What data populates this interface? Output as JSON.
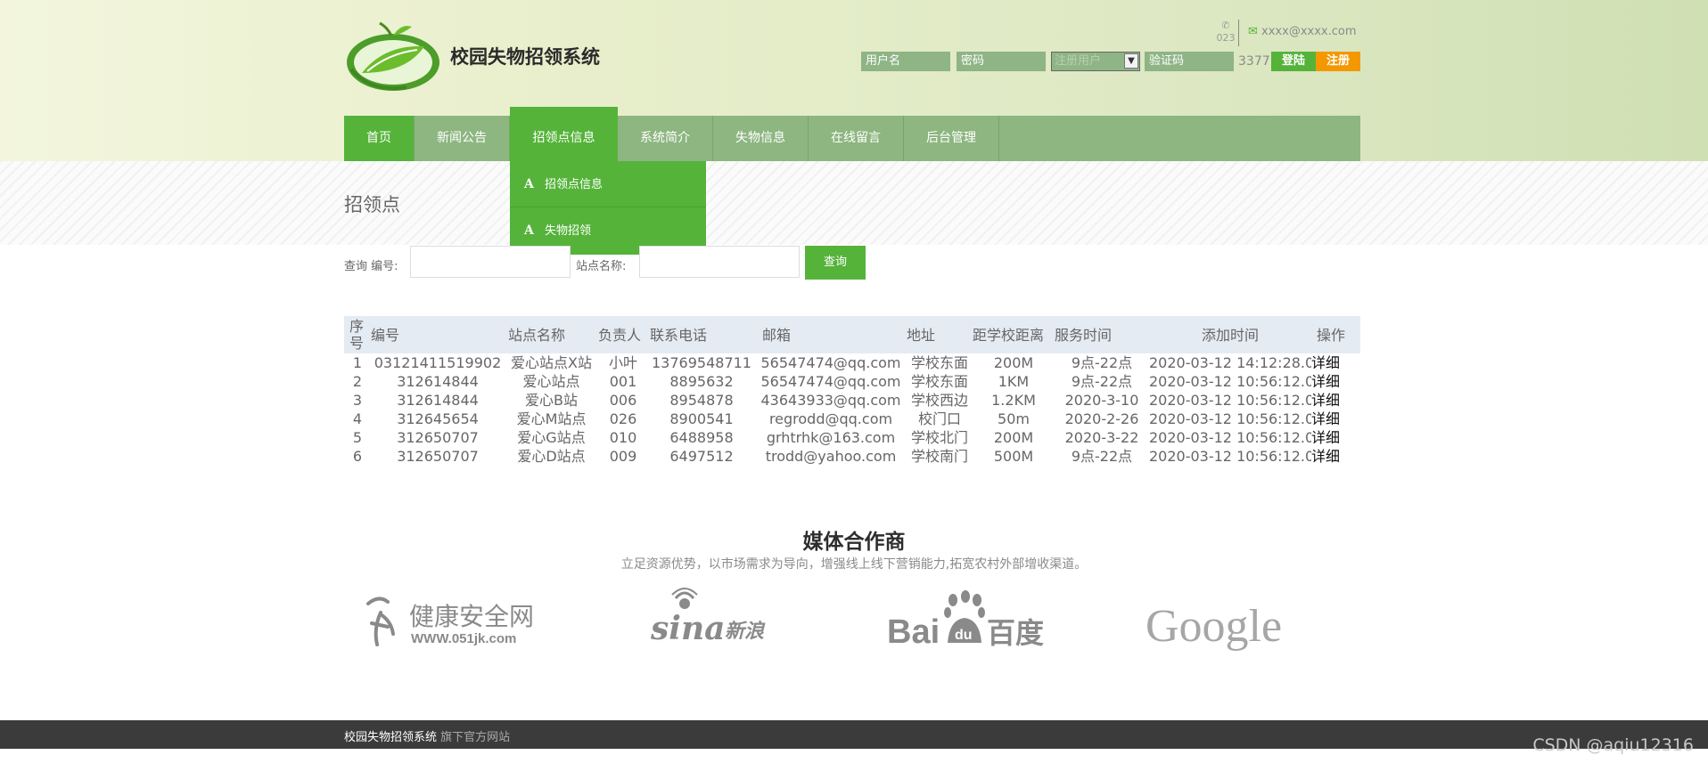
{
  "header": {
    "site_title": "校园失物招领系统",
    "phone_icon": "phone-icon",
    "phone_text": "023",
    "email_icon": "envelope-icon",
    "email": "xxxx@xxxx.com"
  },
  "login": {
    "username_placeholder": "用户名",
    "password_placeholder": "密码",
    "role_selected": "注册用户",
    "captcha_placeholder": "验证码",
    "captcha_code": "3377",
    "login_label": "登陆",
    "register_label": "注册"
  },
  "nav": {
    "items": [
      {
        "label": "首页"
      },
      {
        "label": "新闻公告"
      },
      {
        "label": "招领点信息"
      },
      {
        "label": "系统简介"
      },
      {
        "label": "失物信息"
      },
      {
        "label": "在线留言"
      },
      {
        "label": "后台管理"
      }
    ],
    "dropdown": [
      {
        "label": "招领点信息",
        "icon": "A"
      },
      {
        "label": "失物招领",
        "icon": "A"
      }
    ]
  },
  "page": {
    "section_title": "招领点",
    "search": {
      "label_prefix": "查询 编号:",
      "label_name": "站点名称:",
      "button": "查询"
    }
  },
  "table": {
    "headers": [
      "序号",
      "编号",
      "站点名称",
      "负责人",
      "联系电话",
      "邮箱",
      "地址",
      "距学校距离",
      "服务时间",
      "添加时间",
      "操作"
    ],
    "rows": [
      [
        "1",
        "03121411519902",
        "爱心站点X站",
        "小叶",
        "13769548711",
        "56547474@qq.com",
        "学校东面",
        "200M",
        "9点-22点",
        "2020-03-12 14:12:28.0",
        "详细"
      ],
      [
        "2",
        "312614844",
        "爱心站点",
        "001",
        "8895632",
        "56547474@qq.com",
        "学校东面",
        "1KM",
        "9点-22点",
        "2020-03-12 10:56:12.0",
        "详细"
      ],
      [
        "3",
        "312614844",
        "爱心B站",
        "006",
        "8954878",
        "43643933@qq.com",
        "学校西边",
        "1.2KM",
        "2020-3-10",
        "2020-03-12 10:56:12.0",
        "详细"
      ],
      [
        "4",
        "312645654",
        "爱心M站点",
        "026",
        "8900541",
        "regrodd@qq.com",
        "校门口",
        "50m",
        "2020-2-26",
        "2020-03-12 10:56:12.0",
        "详细"
      ],
      [
        "5",
        "312650707",
        "爱心G站点",
        "010",
        "6488958",
        "grhtrhk@163.com",
        "学校北门",
        "200M",
        "2020-3-22",
        "2020-03-12 10:56:12.0",
        "详细"
      ],
      [
        "6",
        "312650707",
        "爱心D站点",
        "009",
        "6497512",
        "trodd@yahoo.com",
        "学校南门",
        "500M",
        "9点-22点",
        "2020-03-12 10:56:12.0",
        "详细"
      ]
    ]
  },
  "partners": {
    "title": "媒体合作商",
    "subtitle": "立足资源优势，以市场需求为导向，增强线上线下营销能力,拓宽农村外部增收渠道。",
    "logos": [
      {
        "name": "health-logo",
        "text": "健康安全网",
        "sub": "WWW.051jk.com"
      },
      {
        "name": "sina-logo",
        "text": "sina",
        "sub": "新浪"
      },
      {
        "name": "baidu-logo",
        "text": "Bai",
        "mid": "du",
        "sub": "百度"
      },
      {
        "name": "google-logo",
        "text": "Google"
      }
    ]
  },
  "footer": {
    "site": "校园失物招领系统",
    "tagline": " 旗下官方网站"
  },
  "watermark": "CSDN @aqiu12316",
  "colors": {
    "green": "#55b33a",
    "nav_bg": "#8db680",
    "orange": "#f39800",
    "footer_bg": "#3b3b3b"
  }
}
